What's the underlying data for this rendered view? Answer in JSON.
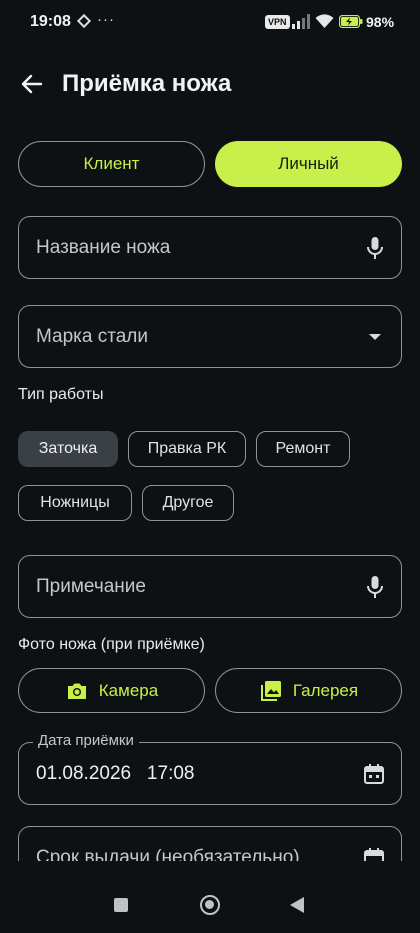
{
  "status_bar": {
    "time": "19:08",
    "dots": "···",
    "vpn": "VPN",
    "battery": "98%"
  },
  "header": {
    "title": "Приёмка ножа"
  },
  "segment": {
    "client": "Клиент",
    "personal": "Личный",
    "selected": "personal"
  },
  "form": {
    "knife_name_placeholder": "Название ножа",
    "steel_grade_placeholder": "Марка стали",
    "work_type_label": "Тип работы",
    "work_types": [
      "Заточка",
      "Правка РК",
      "Ремонт",
      "Ножницы",
      "Другое"
    ],
    "selected_work_type": "Заточка",
    "note_placeholder": "Примечание",
    "photo_label": "Фото ножа (при приёмке)",
    "camera_button": "Камера",
    "gallery_button": "Галерея",
    "accept_date_label": "Дата приёмки",
    "accept_date_value": "01.08.2026   17:08",
    "issue_date_placeholder": "Срок выдачи (необязательно)"
  },
  "colors": {
    "accent": "#c8ef4a",
    "background": "#0d1113",
    "outline": "#8d9499",
    "chip_selected": "#3a4045"
  },
  "icons": [
    "back-arrow-icon",
    "mic-icon",
    "dropdown-caret-icon",
    "camera-icon",
    "gallery-icon",
    "calendar-icon"
  ]
}
